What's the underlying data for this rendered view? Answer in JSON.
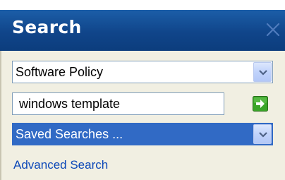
{
  "panel": {
    "title": "Search",
    "close_icon": "close-icon"
  },
  "scope_select": {
    "selected": "Software Policy"
  },
  "query_input": {
    "value": "windows template"
  },
  "go_button": {
    "icon": "green-arrow-right-icon",
    "accent": "#2f9b1f"
  },
  "saved_searches_select": {
    "selected": "Saved Searches ..."
  },
  "advanced_search_link": {
    "label": "Advanced Search"
  },
  "colors": {
    "header": "#10458a",
    "body": "#f1efe2",
    "selection": "#316ac5",
    "link": "#0b47b8"
  }
}
